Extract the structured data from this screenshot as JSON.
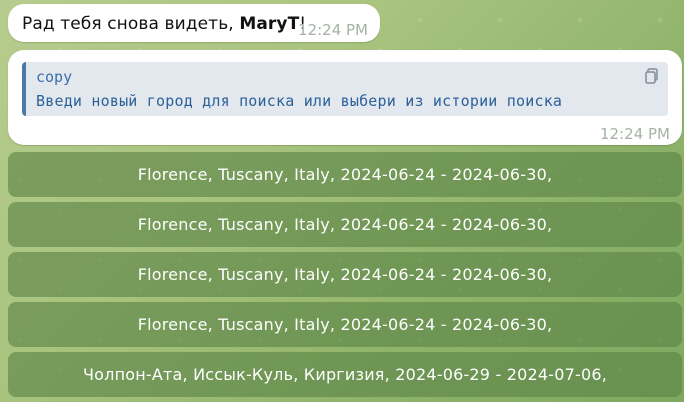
{
  "greeting": {
    "text_prefix": "Рад тебя снова видеть, ",
    "username": "MaryT",
    "text_suffix": "!",
    "time": "12:24 PM"
  },
  "bot_message": {
    "code_language": "copy",
    "code_text": "Введи новый город для поиска или выбери из истории поиска",
    "time": "12:24 PM",
    "copy_icon": "copy-icon"
  },
  "keyboard": {
    "buttons": [
      "Florence, Tuscany, Italy, 2024-06-24 - 2024-06-30,",
      "Florence, Tuscany, Italy, 2024-06-24 - 2024-06-30,",
      "Florence, Tuscany, Italy, 2024-06-24 - 2024-06-30,",
      "Florence, Tuscany, Italy, 2024-06-24 - 2024-06-30,",
      "Чолпон-Ата, Иссык-Куль, Киргизия, 2024-06-29 - 2024-07-06,"
    ]
  },
  "colors": {
    "bubble": "#ffffff",
    "code_accent": "#4d79a6",
    "button_bg": "#5a8246"
  }
}
